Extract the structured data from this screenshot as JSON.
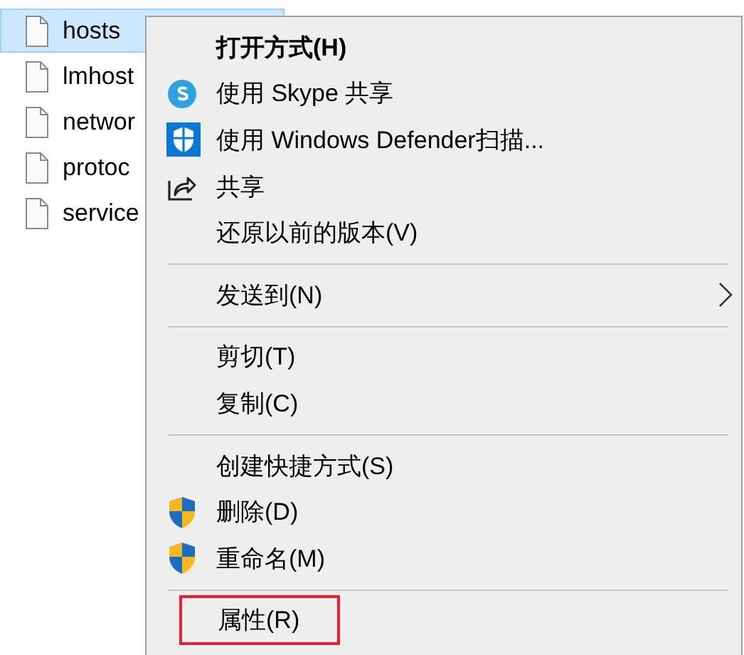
{
  "files": [
    {
      "name": "hosts",
      "selected": true
    },
    {
      "name": "lmhost",
      "selected": false
    },
    {
      "name": "networ",
      "selected": false
    },
    {
      "name": "protoc",
      "selected": false
    },
    {
      "name": "service",
      "selected": false
    }
  ],
  "context_menu": {
    "items": [
      {
        "kind": "item",
        "label": "打开方式(H)",
        "default": true
      },
      {
        "kind": "skype",
        "label": "使用 Skype 共享"
      },
      {
        "kind": "defender",
        "label": "使用 Windows Defender扫描..."
      },
      {
        "kind": "share",
        "label": "共享"
      },
      {
        "kind": "item",
        "label": "还原以前的版本(V)"
      },
      {
        "kind": "separator"
      },
      {
        "kind": "item",
        "label": "发送到(N)",
        "submenu": true
      },
      {
        "kind": "separator"
      },
      {
        "kind": "item",
        "label": "剪切(T)"
      },
      {
        "kind": "item",
        "label": "复制(C)"
      },
      {
        "kind": "separator"
      },
      {
        "kind": "item",
        "label": "创建快捷方式(S)"
      },
      {
        "kind": "uac",
        "label": "删除(D)"
      },
      {
        "kind": "uac",
        "label": "重命名(M)"
      },
      {
        "kind": "separator"
      },
      {
        "kind": "item",
        "label": "属性(R)",
        "outlined": true
      }
    ]
  }
}
